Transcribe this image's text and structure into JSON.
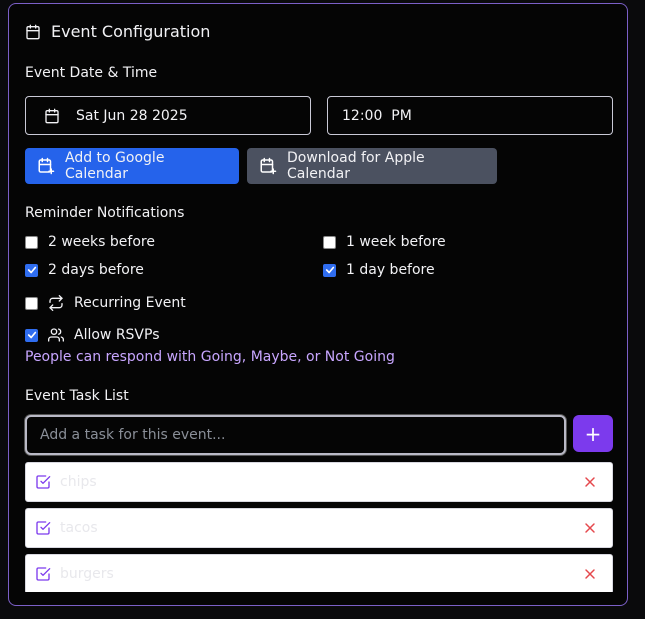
{
  "panel": {
    "title": "Event Configuration"
  },
  "datetime": {
    "label": "Event Date & Time",
    "date_value": "Sat Jun 28 2025",
    "time_value": "12:00  PM"
  },
  "calendar_buttons": {
    "google_label": "Add to Google Calendar",
    "apple_label": "Download for Apple Calendar"
  },
  "reminders": {
    "label": "Reminder Notifications",
    "options": [
      {
        "label": "2 weeks before",
        "checked": false
      },
      {
        "label": "1 week before",
        "checked": true
      },
      {
        "label": "2 days before",
        "checked": true
      },
      {
        "label": "1 day before",
        "checked": true
      }
    ]
  },
  "recurring": {
    "label": "Recurring Event",
    "checked": false
  },
  "rsvp": {
    "label": "Allow RSVPs",
    "checked": true,
    "helper": "People can respond with Going, Maybe, or Not Going"
  },
  "tasks": {
    "label": "Event Task List",
    "input_placeholder": "Add a task for this event...",
    "input_value": "",
    "add_button_symbol": "+",
    "items": [
      {
        "label": "chips"
      },
      {
        "label": "tacos"
      },
      {
        "label": "burgers"
      }
    ]
  },
  "colors": {
    "accent_purple": "#7c3aed",
    "google_blue": "#2563eb",
    "apple_gray": "#4b5160",
    "helper_text": "#c8a6ff",
    "delete_red": "#e5484d"
  },
  "icons": {
    "title": "calendar-icon",
    "date": "calendar-icon",
    "google": "calendar-plus-icon",
    "apple": "calendar-plus-icon",
    "recurring": "repeat-icon",
    "rsvp": "users-icon",
    "task_check": "square-check-icon",
    "task_delete": "x-icon"
  }
}
